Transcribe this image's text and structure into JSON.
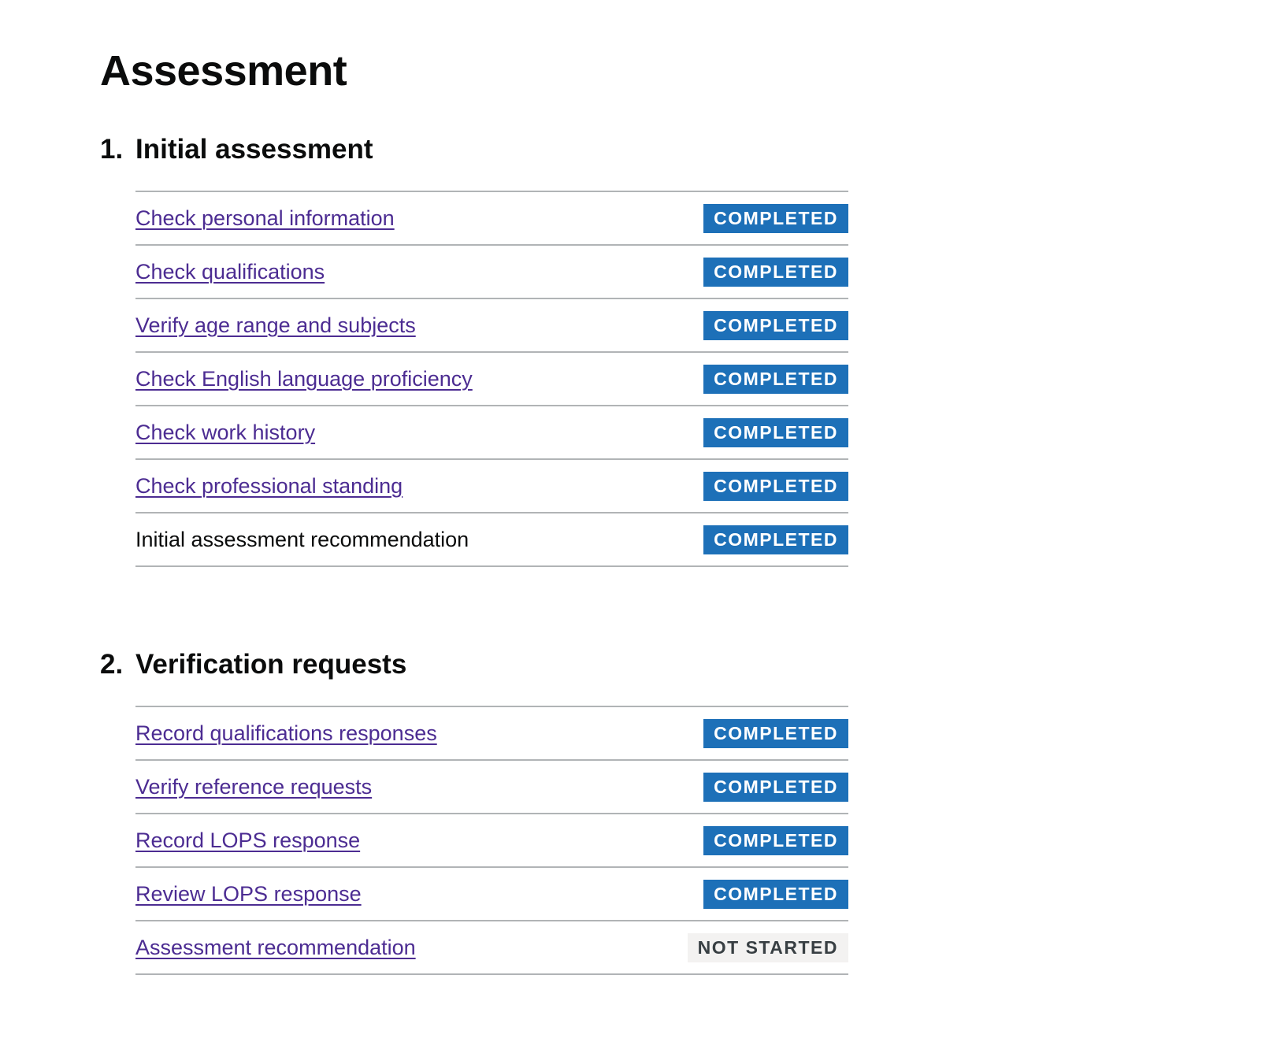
{
  "page": {
    "title": "Assessment"
  },
  "sections": [
    {
      "number": "1.",
      "title": "Initial assessment",
      "tasks": [
        {
          "label": "Check personal information",
          "status": "COMPLETED",
          "link": true
        },
        {
          "label": "Check qualifications",
          "status": "COMPLETED",
          "link": true
        },
        {
          "label": "Verify age range and subjects",
          "status": "COMPLETED",
          "link": true
        },
        {
          "label": "Check English language proficiency",
          "status": "COMPLETED",
          "link": true
        },
        {
          "label": "Check work history",
          "status": "COMPLETED",
          "link": true
        },
        {
          "label": "Check professional standing",
          "status": "COMPLETED",
          "link": true
        },
        {
          "label": "Initial assessment recommendation",
          "status": "COMPLETED",
          "link": false
        }
      ]
    },
    {
      "number": "2.",
      "title": "Verification requests",
      "tasks": [
        {
          "label": "Record qualifications responses",
          "status": "COMPLETED",
          "link": true
        },
        {
          "label": "Verify reference requests",
          "status": "COMPLETED",
          "link": true
        },
        {
          "label": "Record LOPS response",
          "status": "COMPLETED",
          "link": true
        },
        {
          "label": "Review LOPS response",
          "status": "COMPLETED",
          "link": true
        },
        {
          "label": "Assessment recommendation",
          "status": "NOT STARTED",
          "link": true
        }
      ]
    }
  ],
  "colors": {
    "link": "#4c2c92",
    "tag_completed_bg": "#1d70b8",
    "tag_not_started_bg": "#f3f2f1",
    "divider": "#b1b4b6"
  }
}
